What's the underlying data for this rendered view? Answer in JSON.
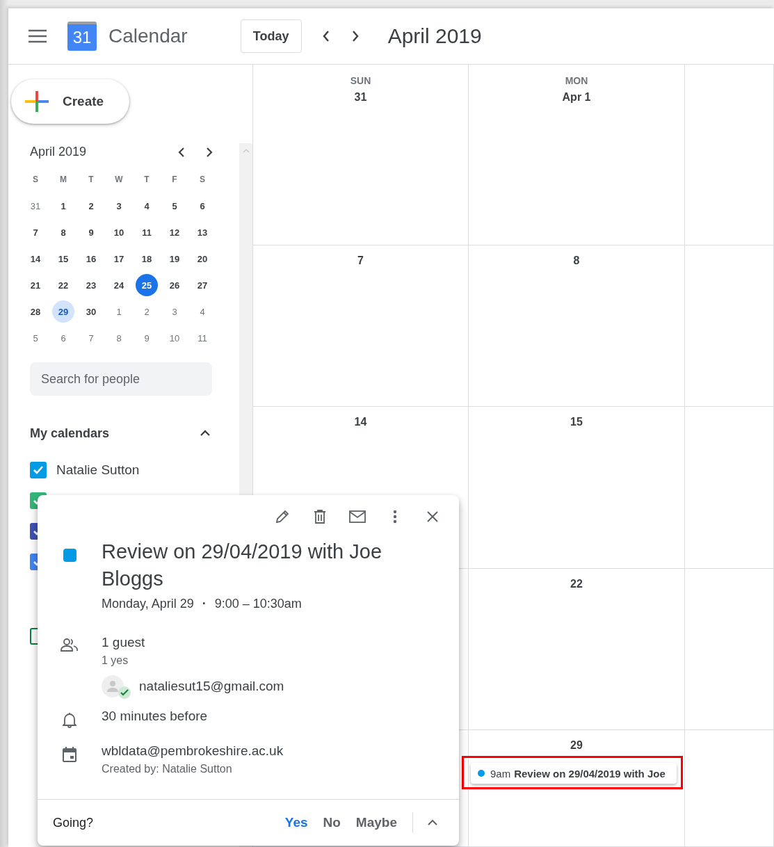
{
  "header": {
    "app_name": "Calendar",
    "logo_number": "31",
    "today_button": "Today",
    "period": "April 2019"
  },
  "sidebar": {
    "create_button": "Create",
    "mini_calendar": {
      "title": "April 2019",
      "weekdays": [
        "S",
        "M",
        "T",
        "W",
        "T",
        "F",
        "S"
      ],
      "days": [
        {
          "day": "31",
          "muted": true,
          "today": false,
          "selected": false
        },
        {
          "day": "1",
          "muted": false,
          "today": false,
          "selected": false
        },
        {
          "day": "2",
          "muted": false,
          "today": false,
          "selected": false
        },
        {
          "day": "3",
          "muted": false,
          "today": false,
          "selected": false
        },
        {
          "day": "4",
          "muted": false,
          "today": false,
          "selected": false
        },
        {
          "day": "5",
          "muted": false,
          "today": false,
          "selected": false
        },
        {
          "day": "6",
          "muted": false,
          "today": false,
          "selected": false
        },
        {
          "day": "7",
          "muted": false,
          "today": false,
          "selected": false
        },
        {
          "day": "8",
          "muted": false,
          "today": false,
          "selected": false
        },
        {
          "day": "9",
          "muted": false,
          "today": false,
          "selected": false
        },
        {
          "day": "10",
          "muted": false,
          "today": false,
          "selected": false
        },
        {
          "day": "11",
          "muted": false,
          "today": false,
          "selected": false
        },
        {
          "day": "12",
          "muted": false,
          "today": false,
          "selected": false
        },
        {
          "day": "13",
          "muted": false,
          "today": false,
          "selected": false
        },
        {
          "day": "14",
          "muted": false,
          "today": false,
          "selected": false
        },
        {
          "day": "15",
          "muted": false,
          "today": false,
          "selected": false
        },
        {
          "day": "16",
          "muted": false,
          "today": false,
          "selected": false
        },
        {
          "day": "17",
          "muted": false,
          "today": false,
          "selected": false
        },
        {
          "day": "18",
          "muted": false,
          "today": false,
          "selected": false
        },
        {
          "day": "19",
          "muted": false,
          "today": false,
          "selected": false
        },
        {
          "day": "20",
          "muted": false,
          "today": false,
          "selected": false
        },
        {
          "day": "21",
          "muted": false,
          "today": false,
          "selected": false
        },
        {
          "day": "22",
          "muted": false,
          "today": false,
          "selected": false
        },
        {
          "day": "23",
          "muted": false,
          "today": false,
          "selected": false
        },
        {
          "day": "24",
          "muted": false,
          "today": false,
          "selected": false
        },
        {
          "day": "25",
          "muted": false,
          "today": true,
          "selected": false
        },
        {
          "day": "26",
          "muted": false,
          "today": false,
          "selected": false
        },
        {
          "day": "27",
          "muted": false,
          "today": false,
          "selected": false
        },
        {
          "day": "28",
          "muted": false,
          "today": false,
          "selected": false
        },
        {
          "day": "29",
          "muted": false,
          "today": false,
          "selected": true
        },
        {
          "day": "30",
          "muted": false,
          "today": false,
          "selected": false
        },
        {
          "day": "1",
          "muted": true,
          "today": false,
          "selected": false
        },
        {
          "day": "2",
          "muted": true,
          "today": false,
          "selected": false
        },
        {
          "day": "3",
          "muted": true,
          "today": false,
          "selected": false
        },
        {
          "day": "4",
          "muted": true,
          "today": false,
          "selected": false
        },
        {
          "day": "5",
          "muted": true,
          "today": false,
          "selected": false
        },
        {
          "day": "6",
          "muted": true,
          "today": false,
          "selected": false
        },
        {
          "day": "7",
          "muted": true,
          "today": false,
          "selected": false
        },
        {
          "day": "8",
          "muted": true,
          "today": false,
          "selected": false
        },
        {
          "day": "9",
          "muted": true,
          "today": false,
          "selected": false
        },
        {
          "day": "10",
          "muted": true,
          "today": false,
          "selected": false
        },
        {
          "day": "11",
          "muted": true,
          "today": false,
          "selected": false
        }
      ]
    },
    "search": {
      "placeholder": "Search for people"
    },
    "my_calendars": {
      "heading": "My calendars",
      "expanded": true,
      "items": [
        {
          "label": "Natalie Sutton",
          "checked": true,
          "color": "#039be5"
        },
        {
          "checked": true,
          "color": "#33b679"
        },
        {
          "checked": true,
          "color": "#3f51b5"
        },
        {
          "checked": true,
          "color": "#4285f4"
        }
      ]
    },
    "other_calendars": {
      "items": [
        {
          "checked": false,
          "color": "#0b8043"
        }
      ]
    }
  },
  "month": {
    "columns": [
      {
        "weekday": "SUN"
      },
      {
        "weekday": "MON"
      }
    ],
    "weeks": [
      {
        "sun": "31",
        "mon": "Apr 1"
      },
      {
        "sun": "7",
        "mon": "8"
      },
      {
        "sun": "14",
        "mon": "15"
      },
      {
        "mon": "22"
      },
      {
        "mon": "29",
        "event": {
          "time": "9am",
          "title": "Review on 29/04/2019 with Joe",
          "color": "#039be5",
          "highlighted": true
        }
      }
    ]
  },
  "event_popup": {
    "color": "#039be5",
    "title": "Review on 29/04/2019 with Joe Bloggs",
    "date": "Monday, April 29",
    "separator": "·",
    "time": "9:00 – 10:30am",
    "guests_count": "1 guest",
    "guests_summary": "1 yes",
    "guests": [
      {
        "email": "nataliesut15@gmail.com",
        "accepted": true
      }
    ],
    "reminder": "30 minutes before",
    "calendar": "wbldata@pembrokeshire.ac.uk",
    "created_by": "Created by: Natalie Sutton",
    "rsvp": {
      "label": "Going?",
      "options": [
        {
          "label": "Yes",
          "selected": true
        },
        {
          "label": "No",
          "selected": false
        },
        {
          "label": "Maybe",
          "selected": false
        }
      ]
    }
  }
}
